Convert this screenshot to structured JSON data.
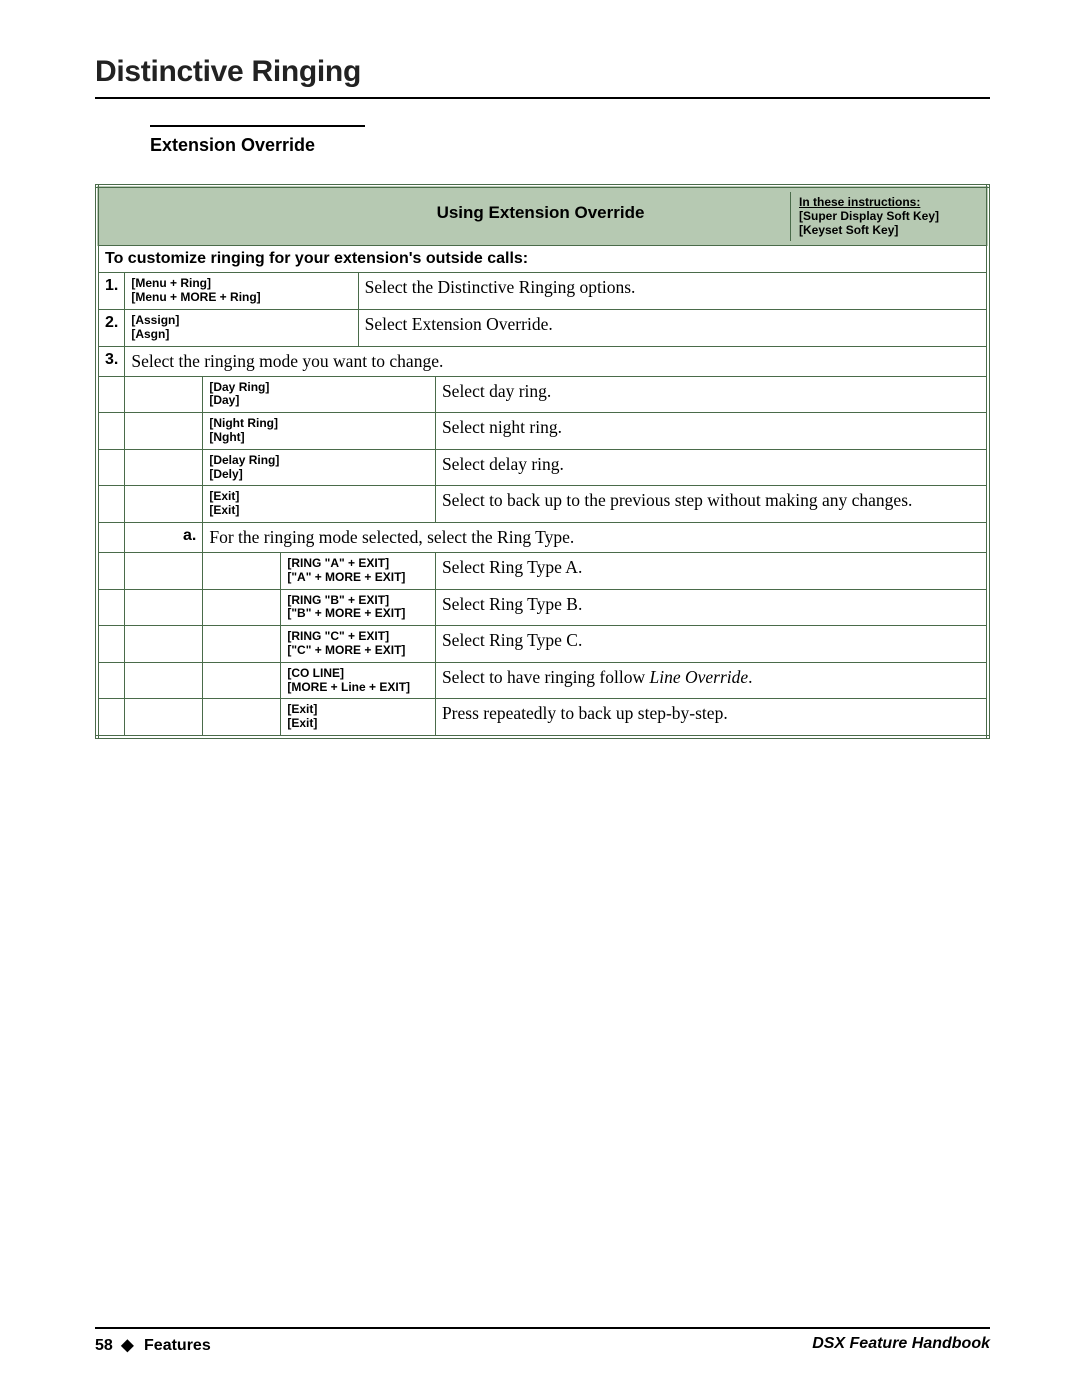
{
  "title": "Distinctive Ringing",
  "section_heading": "Extension Override",
  "table": {
    "header_center": "Using Extension Override",
    "header_right": {
      "line1": "In these instructions:",
      "line2": "[Super Display Soft Key]",
      "line3": "[Keyset Soft Key]"
    },
    "subheader": "To customize ringing for your extension's outside calls:",
    "steps": [
      {
        "num": "1.",
        "softkey1": "[Menu + Ring]",
        "softkey2": "[Menu + MORE + Ring]",
        "desc": "Select the Distinctive Ringing options."
      },
      {
        "num": "2.",
        "softkey1": "[Assign]",
        "softkey2": "[Asgn]",
        "desc": "Select Extension Override."
      },
      {
        "num": "3.",
        "desc": "Select the ringing mode you want to change."
      }
    ],
    "modes": [
      {
        "softkey1": "[Day Ring]",
        "softkey2": "[Day]",
        "desc": "Select day ring."
      },
      {
        "softkey1": "[Night Ring]",
        "softkey2": "[Nght]",
        "desc": "Select night ring."
      },
      {
        "softkey1": "[Delay Ring]",
        "softkey2": "[Dely]",
        "desc": "Select delay ring."
      },
      {
        "softkey1": "[Exit]",
        "softkey2": "[Exit]",
        "desc": "Select to back up to the previous step without making any changes."
      }
    ],
    "substep": {
      "letter": "a.",
      "desc": "For the ringing mode selected, select the Ring Type."
    },
    "ringtypes": [
      {
        "softkey1": "[RING \"A\" + EXIT]",
        "softkey2": "[\"A\" + MORE + EXIT]",
        "desc": "Select Ring Type A."
      },
      {
        "softkey1": "[RING \"B\" + EXIT]",
        "softkey2": "[\"B\" + MORE + EXIT]",
        "desc": "Select Ring Type B."
      },
      {
        "softkey1": "[RING \"C\" + EXIT]",
        "softkey2": "[\"C\" + MORE + EXIT]",
        "desc": "Select Ring Type C."
      },
      {
        "softkey1": "[CO LINE]",
        "softkey2": "[MORE + Line + EXIT]",
        "desc_pre": "Select to have ringing follow ",
        "desc_ital": "Line Override",
        "desc_post": "."
      },
      {
        "softkey1": "[Exit]",
        "softkey2": "[Exit]",
        "desc": "Press repeatedly to back up step-by-step."
      }
    ]
  },
  "footer": {
    "page_num": "58",
    "diamond": "◆",
    "section": "Features",
    "book": "DSX Feature Handbook"
  }
}
